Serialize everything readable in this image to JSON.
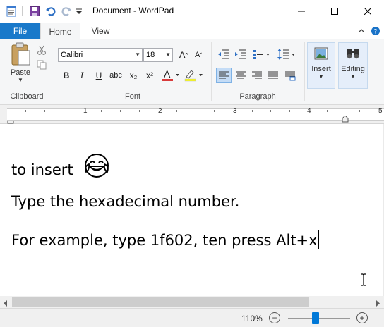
{
  "window": {
    "title": "Document - WordPad",
    "minimize_glyph": "—",
    "maximize_glyph": "☐",
    "close_glyph": "✕"
  },
  "tabs": [
    {
      "label": "File"
    },
    {
      "label": "Home"
    },
    {
      "label": "View"
    }
  ],
  "ribbon": {
    "clipboard": {
      "paste_label": "Paste",
      "group_label": "Clipboard"
    },
    "font": {
      "font_name": "Calibri",
      "font_size": "18",
      "group_label": "Font",
      "bold": "B",
      "italic": "I",
      "underline": "U",
      "strike": "abc",
      "subscript": "x₂",
      "superscript": "x²",
      "grow": "A",
      "shrink": "A"
    },
    "paragraph": {
      "group_label": "Paragraph"
    },
    "insert": {
      "label": "Insert"
    },
    "editing": {
      "label": "Editing"
    }
  },
  "ruler": {
    "numbers": [
      "1",
      "2",
      "3",
      "4",
      "5"
    ]
  },
  "document": {
    "line1": "to insert",
    "emoji": "😂",
    "line2": "Type the hexadecimal number.",
    "line3": "For example, type 1f602, ten press Alt+x"
  },
  "status": {
    "zoom": "110%",
    "zoom_out": "−",
    "zoom_in": "+",
    "zoom_fraction": 0.44
  },
  "colors": {
    "file_tab": "#1979ca",
    "accent": "#0078d7",
    "font_color_underline": "#d83b3b",
    "highlight_underline": "#ffff00"
  }
}
